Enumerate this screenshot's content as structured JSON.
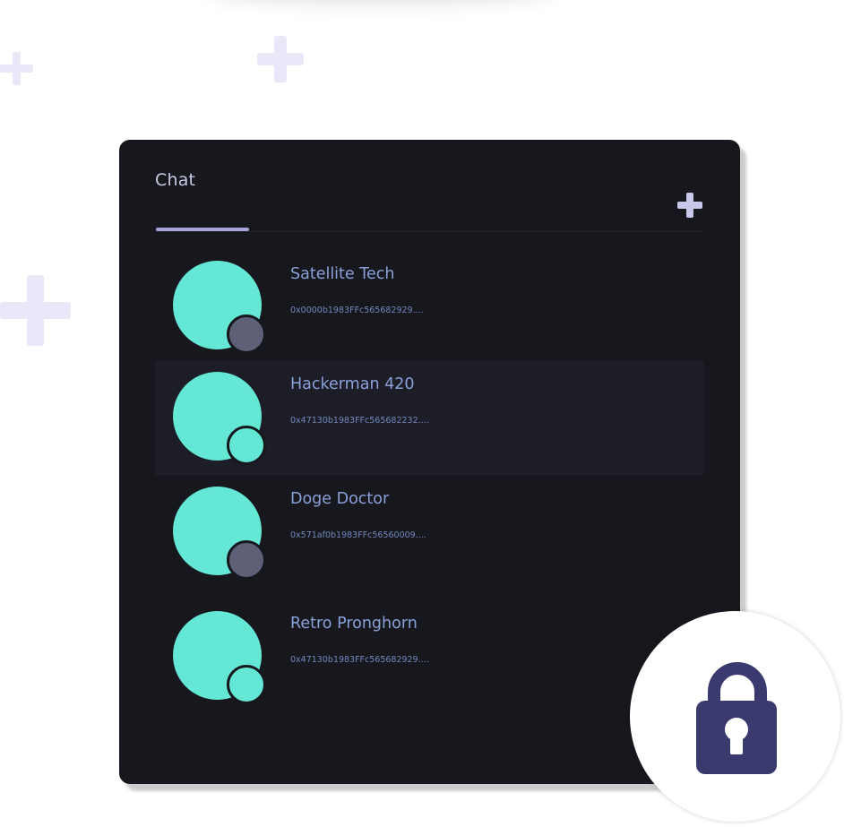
{
  "chat": {
    "title": "Chat",
    "tabs": [
      {
        "label": "",
        "selected": true
      }
    ],
    "contacts": [
      {
        "name": "Satellite Tech",
        "address": "0x0000b1983FFc565682929....",
        "status": "offline",
        "selected": false
      },
      {
        "name": "Hackerman 420",
        "address": "0x47130b1983FFc565682232....",
        "status": "online",
        "selected": true
      },
      {
        "name": "Doge Doctor",
        "address": "0x571af0b1983FFc56560009....",
        "status": "offline",
        "selected": false
      },
      {
        "name": "Retro Pronghorn",
        "address": "0x47130b1983FFc565682929....",
        "status": "online",
        "selected": false
      }
    ]
  },
  "icons": {
    "add": "plus-icon",
    "lock": "lock-icon",
    "decoration": "plus-decoration-icon"
  },
  "colors": {
    "card_background": "#17181e",
    "avatar": "#64e8d5",
    "status_offline": "#5d6077",
    "status_online": "#64e8d5",
    "accent": "#a6a4d8",
    "lock": "#3b3a6e",
    "name_text": "#8aa0d8",
    "decoration": "#e9e8f8"
  }
}
